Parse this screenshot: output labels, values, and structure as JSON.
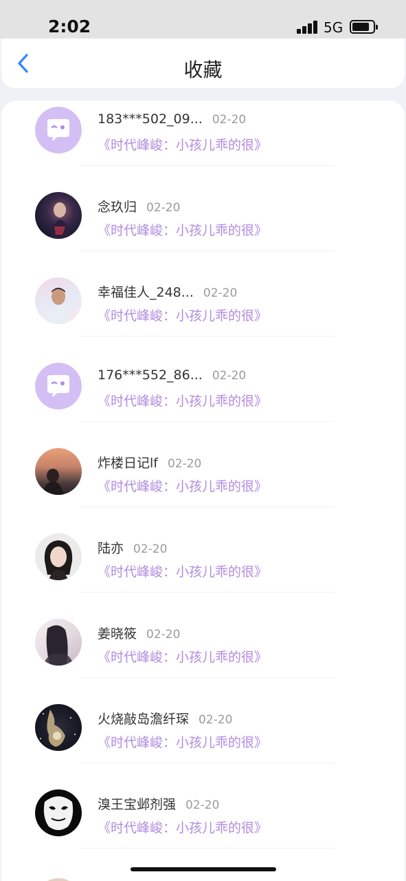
{
  "status_bar": {
    "time": "2:02",
    "network": "5G"
  },
  "nav": {
    "title": "收藏",
    "back_icon": "chevron-left-icon"
  },
  "colors": {
    "accent": "#2f86ff",
    "subtitle": "#b18be0",
    "default_avatar": "#d3bff4"
  },
  "items": [
    {
      "name": "183***502_09...",
      "date": "02-20",
      "subtitle": "《时代峰峻：小孩儿乖的很》",
      "avatar": "default-chat-avatar"
    },
    {
      "name": "念玖归",
      "date": "02-20",
      "subtitle": "《时代峰峻：小孩儿乖的很》",
      "avatar": "photo-avatar"
    },
    {
      "name": "幸福佳人_248...",
      "date": "02-20",
      "subtitle": "《时代峰峻：小孩儿乖的很》",
      "avatar": "photo-avatar"
    },
    {
      "name": "176***552_86...",
      "date": "02-20",
      "subtitle": "《时代峰峻：小孩儿乖的很》",
      "avatar": "default-chat-avatar"
    },
    {
      "name": "炸楼日记lf",
      "date": "02-20",
      "subtitle": "《时代峰峻：小孩儿乖的很》",
      "avatar": "photo-avatar"
    },
    {
      "name": "陆亦",
      "date": "02-20",
      "subtitle": "《时代峰峻：小孩儿乖的很》",
      "avatar": "photo-avatar"
    },
    {
      "name": "姜晓筱",
      "date": "02-20",
      "subtitle": "《时代峰峻：小孩儿乖的很》",
      "avatar": "photo-avatar"
    },
    {
      "name": "火烧敲岛澹纤琛",
      "date": "02-20",
      "subtitle": "《时代峰峻：小孩儿乖的很》",
      "avatar": "photo-avatar"
    },
    {
      "name": "溴王宝邺剂强",
      "date": "02-20",
      "subtitle": "《时代峰峻：小孩儿乖的很》",
      "avatar": "photo-avatar"
    }
  ]
}
